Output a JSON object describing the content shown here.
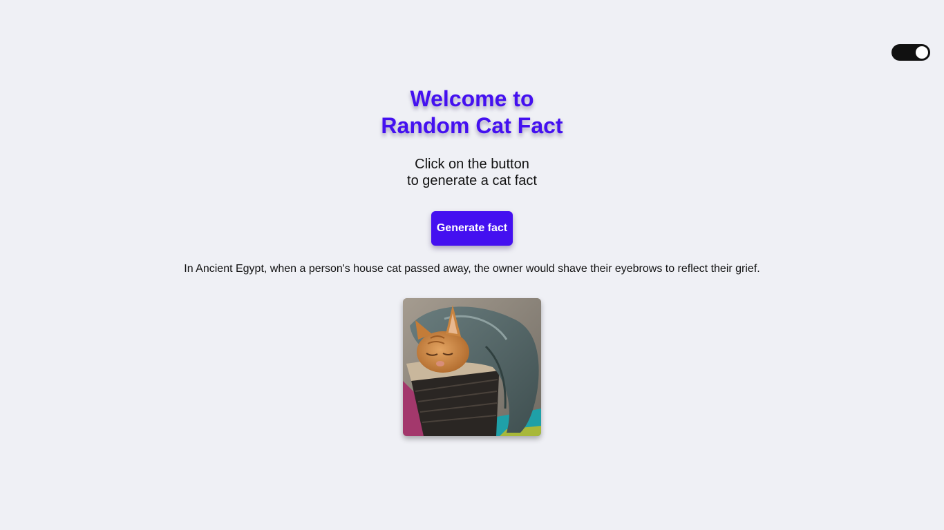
{
  "header": {
    "title_line1": "Welcome to",
    "title_line2": "Random Cat Fact"
  },
  "intro": {
    "line1": "Click on the button",
    "line2": "to generate a cat fact"
  },
  "controls": {
    "generate_label": "Generate fact",
    "theme_toggle": "on"
  },
  "fact": {
    "text": "In Ancient Egypt, when a person's house cat passed away, the owner would shave their eyebrows to reflect their grief."
  },
  "image": {
    "subject": "orange tabby cat sleeping in a wicker basket under a gray towel"
  },
  "colors": {
    "accent": "#4410f0",
    "background": "#eff0f5",
    "toggle": "#111111"
  }
}
